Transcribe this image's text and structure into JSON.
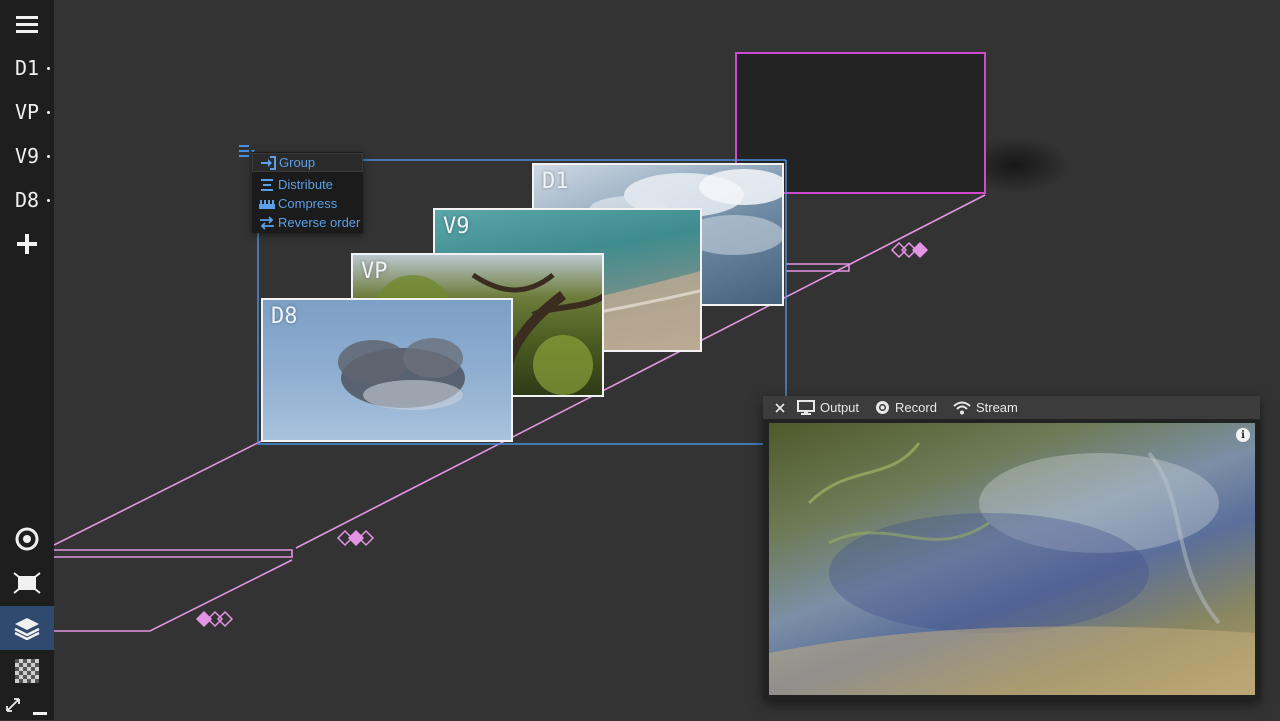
{
  "sidebar": {
    "items": [
      {
        "label": "D1"
      },
      {
        "label": "VP"
      },
      {
        "label": "V9"
      },
      {
        "label": "D8"
      }
    ]
  },
  "layers": [
    {
      "label": "D1"
    },
    {
      "label": "V9"
    },
    {
      "label": "VP"
    },
    {
      "label": "D8"
    }
  ],
  "context_menu": {
    "items": [
      {
        "label": "Group",
        "icon": "group-enter-icon"
      },
      {
        "label": "Distribute",
        "icon": "distribute-icon"
      },
      {
        "label": "Compress",
        "icon": "compress-icon"
      },
      {
        "label": "Reverse order",
        "icon": "reverse-order-icon"
      }
    ]
  },
  "output_panel": {
    "tabs": [
      {
        "label": "Output",
        "icon": "monitor-icon"
      },
      {
        "label": "Record",
        "icon": "record-icon"
      },
      {
        "label": "Stream",
        "icon": "wifi-icon"
      }
    ],
    "info": "i"
  },
  "colors": {
    "accent_blue": "#4a8fe0",
    "accent_pink": "#e88ee8",
    "sidebar_bg": "#1e1e1e",
    "canvas_bg": "#333333"
  }
}
